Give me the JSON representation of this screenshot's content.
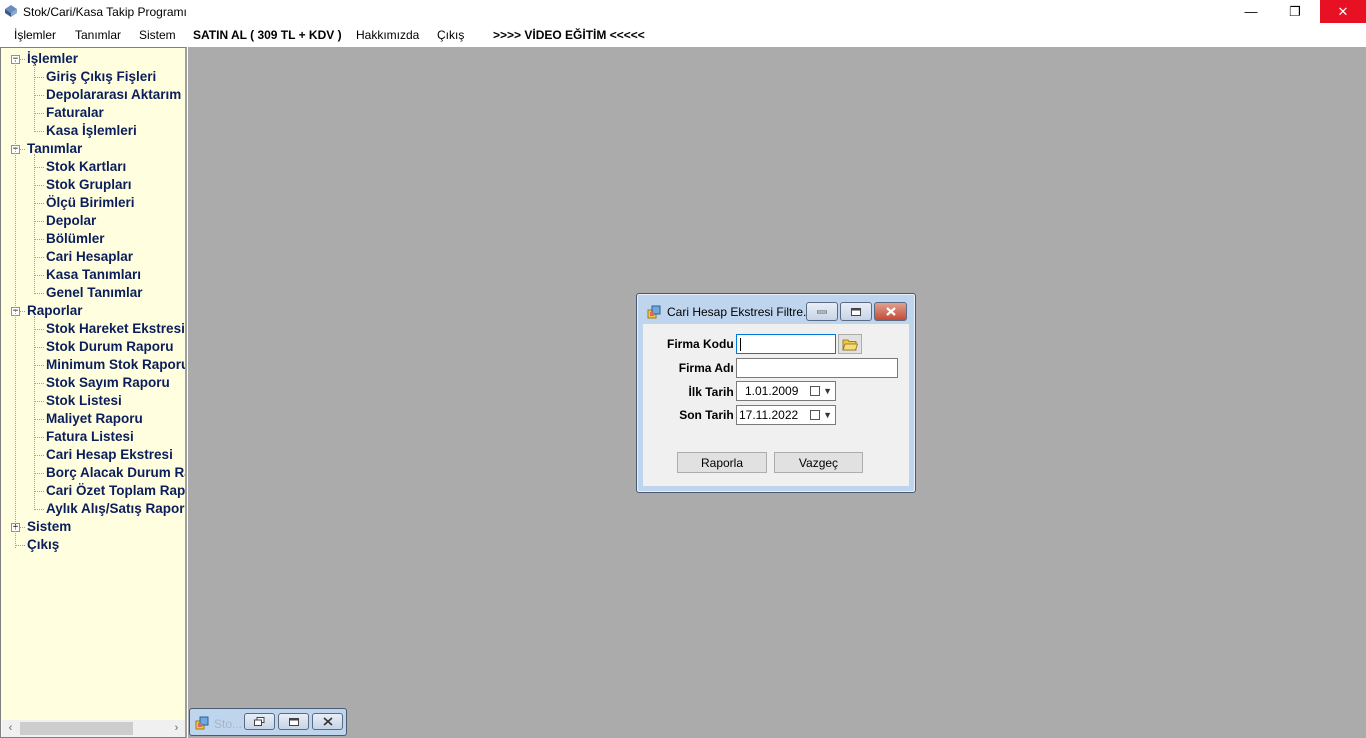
{
  "window": {
    "title": "Stok/Cari/Kasa Takip Programı",
    "minimize_glyph": "—",
    "restore_glyph": "❐",
    "close_glyph": "✕"
  },
  "menu": {
    "items": [
      "İşlemler",
      "Tanımlar",
      "Sistem",
      "SATIN AL ( 309 TL + KDV )",
      "Hakkımızda",
      "Çıkış",
      ">>>> VİDEO EĞİTİM <<<<<"
    ]
  },
  "tree": {
    "groups": [
      {
        "label": "İşlemler",
        "expander": "−",
        "children": [
          "Giriş Çıkış Fişleri",
          "Depolararası Aktarım",
          "Faturalar",
          "Kasa İşlemleri"
        ]
      },
      {
        "label": "Tanımlar",
        "expander": "−",
        "children": [
          "Stok Kartları",
          "Stok Grupları",
          "Ölçü Birimleri",
          "Depolar",
          "Bölümler",
          "Cari Hesaplar",
          "Kasa Tanımları",
          "Genel Tanımlar"
        ]
      },
      {
        "label": "Raporlar",
        "expander": "−",
        "children": [
          "Stok Hareket Ekstresi",
          "Stok Durum Raporu",
          "Minimum Stok Raporu",
          "Stok Sayım Raporu",
          "Stok Listesi",
          "Maliyet Raporu",
          "Fatura Listesi",
          "Cari Hesap Ekstresi",
          "Borç Alacak Durum Raporu",
          "Cari Özet Toplam Raporu",
          "Aylık Alış/Satış Raporu"
        ]
      },
      {
        "label": "Sistem",
        "expander": "+",
        "children": []
      },
      {
        "label": "Çıkış",
        "expander": "",
        "children": []
      }
    ],
    "scroll_left": "‹",
    "scroll_right": "›"
  },
  "dialog": {
    "title": "Cari Hesap Ekstresi Filtre...",
    "firma_kodu_label": "Firma Kodu :",
    "firma_kodu_value": "",
    "firma_adi_label": "Firma Adı :",
    "firma_adi_value": "",
    "ilk_tarih_label": "İlk Tarih :",
    "ilk_tarih_value": "1.01.2009",
    "son_tarih_label": "Son Tarih :",
    "son_tarih_value": "17.11.2022",
    "raporla_button": "Raporla",
    "vazgec_button": "Vazgeç",
    "dropdown_glyph": "▼"
  },
  "minimized_child": {
    "title": "Sto..."
  },
  "colors": {
    "tree_text": "#0b1e5b",
    "tree_background": "#ffffe0",
    "mdi_background": "#ababab",
    "close_red": "#e81123"
  }
}
